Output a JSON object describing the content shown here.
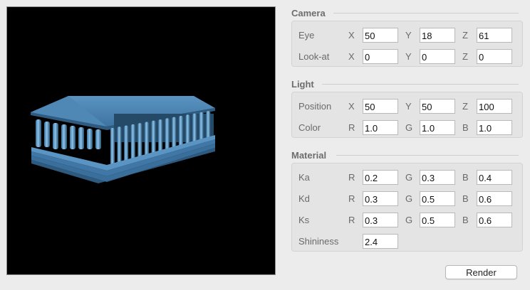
{
  "camera": {
    "title": "Camera",
    "eye": {
      "label": "Eye",
      "x_label": "X",
      "y_label": "Y",
      "z_label": "Z",
      "x": "50",
      "y": "18",
      "z": "61"
    },
    "look_at": {
      "label": "Look-at",
      "x_label": "X",
      "y_label": "Y",
      "z_label": "Z",
      "x": "0",
      "y": "0",
      "z": "0"
    }
  },
  "light": {
    "title": "Light",
    "position": {
      "label": "Position",
      "x_label": "X",
      "y_label": "Y",
      "z_label": "Z",
      "x": "50",
      "y": "50",
      "z": "100"
    },
    "color": {
      "label": "Color",
      "r_label": "R",
      "g_label": "G",
      "b_label": "B",
      "r": "1.0",
      "g": "1.0",
      "b": "1.0"
    }
  },
  "material": {
    "title": "Material",
    "ka": {
      "label": "Ka",
      "r_label": "R",
      "g_label": "G",
      "b_label": "B",
      "r": "0.2",
      "g": "0.3",
      "b": "0.4"
    },
    "kd": {
      "label": "Kd",
      "r_label": "R",
      "g_label": "G",
      "b_label": "B",
      "r": "0.3",
      "g": "0.5",
      "b": "0.6"
    },
    "ks": {
      "label": "Ks",
      "r_label": "R",
      "g_label": "G",
      "b_label": "B",
      "r": "0.3",
      "g": "0.5",
      "b": "0.6"
    },
    "shininess": {
      "label": "Shininess",
      "value": "2.4"
    }
  },
  "render_button": {
    "label": "Render"
  },
  "colors": {
    "viewport_bg": "#000000",
    "model_light": "#6aa8d8",
    "model_mid": "#4a86b4",
    "model_dark": "#2a5272"
  }
}
